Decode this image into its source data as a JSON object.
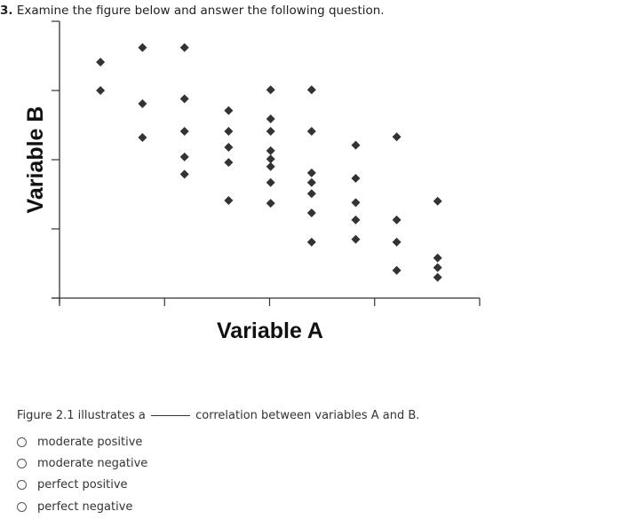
{
  "question": {
    "number": "3.",
    "text": "Examine the figure below and answer the following question."
  },
  "chart_data": {
    "type": "scatter",
    "title": "",
    "xlabel": "Variable A",
    "ylabel": "Variable B",
    "xlim": [
      0,
      4
    ],
    "ylim": [
      0,
      4
    ],
    "xticks": [
      0,
      1,
      2,
      3,
      4
    ],
    "yticks": [
      0,
      1,
      2,
      3,
      4
    ],
    "tick_labels_shown": false,
    "grid": false,
    "marker": "diamond",
    "marker_color": "#333333",
    "points": [
      {
        "x": 0.39,
        "y": 3.41
      },
      {
        "x": 0.39,
        "y": 3.0
      },
      {
        "x": 0.79,
        "y": 3.62
      },
      {
        "x": 0.79,
        "y": 2.81
      },
      {
        "x": 0.79,
        "y": 2.32
      },
      {
        "x": 1.19,
        "y": 3.62
      },
      {
        "x": 1.19,
        "y": 2.88
      },
      {
        "x": 1.19,
        "y": 2.41
      },
      {
        "x": 1.19,
        "y": 2.04
      },
      {
        "x": 1.19,
        "y": 1.79
      },
      {
        "x": 1.61,
        "y": 2.71
      },
      {
        "x": 1.61,
        "y": 2.41
      },
      {
        "x": 1.61,
        "y": 2.18
      },
      {
        "x": 1.61,
        "y": 1.96
      },
      {
        "x": 1.61,
        "y": 1.41
      },
      {
        "x": 2.01,
        "y": 3.01
      },
      {
        "x": 2.01,
        "y": 2.59
      },
      {
        "x": 2.01,
        "y": 2.41
      },
      {
        "x": 2.01,
        "y": 2.13
      },
      {
        "x": 2.01,
        "y": 2.01
      },
      {
        "x": 2.01,
        "y": 1.9
      },
      {
        "x": 2.01,
        "y": 1.67
      },
      {
        "x": 2.01,
        "y": 1.37
      },
      {
        "x": 2.4,
        "y": 3.01
      },
      {
        "x": 2.4,
        "y": 2.41
      },
      {
        "x": 2.4,
        "y": 1.81
      },
      {
        "x": 2.4,
        "y": 1.67
      },
      {
        "x": 2.4,
        "y": 1.51
      },
      {
        "x": 2.4,
        "y": 1.23
      },
      {
        "x": 2.4,
        "y": 0.81
      },
      {
        "x": 2.82,
        "y": 2.21
      },
      {
        "x": 2.82,
        "y": 1.73
      },
      {
        "x": 2.82,
        "y": 1.38
      },
      {
        "x": 2.82,
        "y": 1.13
      },
      {
        "x": 2.82,
        "y": 0.85
      },
      {
        "x": 3.21,
        "y": 2.33
      },
      {
        "x": 3.21,
        "y": 1.13
      },
      {
        "x": 3.21,
        "y": 0.81
      },
      {
        "x": 3.21,
        "y": 0.4
      },
      {
        "x": 3.6,
        "y": 1.4
      },
      {
        "x": 3.6,
        "y": 0.58
      },
      {
        "x": 3.6,
        "y": 0.44
      },
      {
        "x": 3.6,
        "y": 0.3
      }
    ]
  },
  "prompt": {
    "before_blank": "Figure 2.1 illustrates a",
    "after_blank": "correlation between variables A and B."
  },
  "options": [
    {
      "label": "moderate positive",
      "selected": false
    },
    {
      "label": "moderate negative",
      "selected": false
    },
    {
      "label": "perfect positive",
      "selected": false
    },
    {
      "label": "perfect negative",
      "selected": false
    }
  ]
}
